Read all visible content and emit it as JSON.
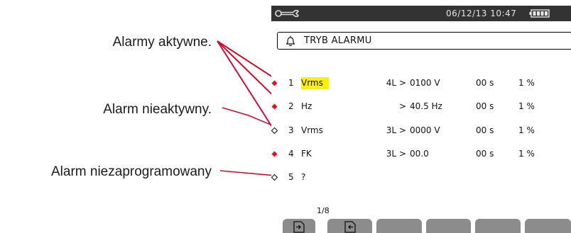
{
  "callouts": {
    "active": "Alarmy aktywne.",
    "inactive": "Alarm nieaktywny.",
    "unprogrammed": "Alarm niezaprogramowany"
  },
  "status_bar": {
    "icon": "wrench-icon",
    "datetime": "06/12/13 10:47",
    "battery_icon": "battery-icon"
  },
  "header": {
    "icon": "bell-icon",
    "title": "TRYB ALARMU"
  },
  "alarms": [
    {
      "number": "1",
      "state": "active",
      "parameter": "Vrms",
      "highlighted": true,
      "phases": "4L >",
      "threshold": "0100 V",
      "duration": "00 s",
      "hysteresis": "1 %"
    },
    {
      "number": "2",
      "state": "active",
      "parameter": "Hz",
      "highlighted": false,
      "phases": ">",
      "threshold": "40.5 Hz",
      "duration": "00 s",
      "hysteresis": "1 %"
    },
    {
      "number": "3",
      "state": "inactive",
      "parameter": "Vrms",
      "highlighted": false,
      "phases": "3L >",
      "threshold": "0000 V",
      "duration": "00 s",
      "hysteresis": "1 %"
    },
    {
      "number": "4",
      "state": "active",
      "parameter": "FK",
      "highlighted": false,
      "phases": "3L >",
      "threshold": "00.0",
      "duration": "00 s",
      "hysteresis": "1 %"
    },
    {
      "number": "5",
      "state": "unprogrammed",
      "parameter": "?",
      "highlighted": false,
      "phases": "",
      "threshold": "",
      "duration": "",
      "hysteresis": ""
    }
  ],
  "page_indicator": "1/8",
  "softkeys": [
    {
      "icon": "page-forward-icon"
    },
    {
      "icon": "page-back-icon"
    },
    {
      "icon": ""
    },
    {
      "icon": ""
    },
    {
      "icon": ""
    },
    {
      "icon": ""
    }
  ],
  "colors": {
    "active_indicator": "#e8101a",
    "highlight": "#ffef00",
    "status_bar": "#333333",
    "softkey": "#8c8c8c",
    "callout_line": "#c8102e"
  }
}
